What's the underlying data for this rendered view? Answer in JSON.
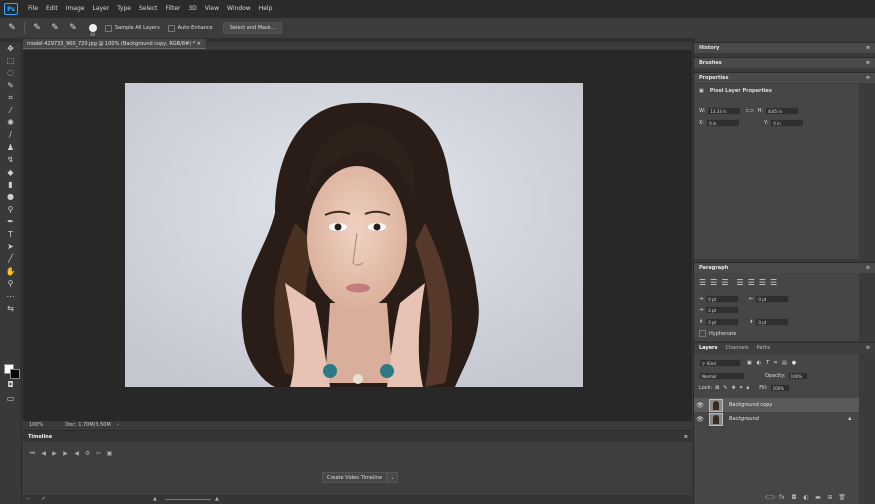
{
  "app": {
    "logo_text": "Ps"
  },
  "menubar": {
    "items": [
      "File",
      "Edit",
      "Image",
      "Layer",
      "Type",
      "Select",
      "Filter",
      "3D",
      "View",
      "Window",
      "Help"
    ]
  },
  "options": {
    "brush_size": "30",
    "sample_all_layers": "Sample All Layers",
    "auto_enhance": "Auto-Enhance",
    "select_mask": "Select and Mask..."
  },
  "document": {
    "tab_title": "model-429733_960_720.jpg @ 100% (Background copy, RGB/8#) *",
    "zoom": "100%",
    "doc_info": "Doc: 1.70M/3.50M"
  },
  "timeline": {
    "title": "Timeline",
    "create_button": "Create Video Timeline"
  },
  "panels": {
    "history": "History",
    "brushes": "Brushes",
    "properties": "Properties",
    "pixel_layer": "Pixel Layer Properties",
    "w_label": "W:",
    "w_value": "13.33 in",
    "h_label": "H:",
    "h_value": "8.85 in",
    "x_label": "X:",
    "x_value": "0 in",
    "y_label": "Y:",
    "y_value": "0 in",
    "paragraph": "Paragraph",
    "para_fields": [
      "0 pt",
      "0 pt",
      "0 pt",
      "0 pt",
      "0 pt"
    ],
    "hyphenate": "Hyphenate",
    "tabs": [
      "Layers",
      "Channels",
      "Paths"
    ],
    "kind": "Kind",
    "blend": "Normal",
    "opacity_label": "Opacity:",
    "opacity_value": "100%",
    "lock_label": "Lock:",
    "fill_label": "Fill:",
    "fill_value": "100%",
    "layers": [
      "Background copy",
      "Background"
    ]
  }
}
